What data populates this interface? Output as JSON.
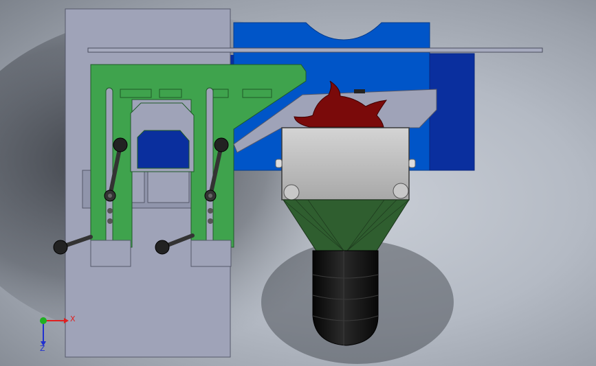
{
  "scene": {
    "colors": {
      "background": "#b4bac4",
      "plate_gray": "#9fa3b8",
      "housing_blue": "#0a2f9e",
      "housing_blue_light": "#0055c8",
      "bracket_green": "#3fa34d",
      "blade_red": "#7a0a0a",
      "motor_box": "#bfbfbf",
      "chute_green": "#2f5e2f",
      "hose_black": "#111111"
    },
    "triad": {
      "x_label": "X",
      "z_label": "Z",
      "x_color": "#e02020",
      "y_color": "#20b020",
      "z_color": "#2030d0"
    }
  }
}
